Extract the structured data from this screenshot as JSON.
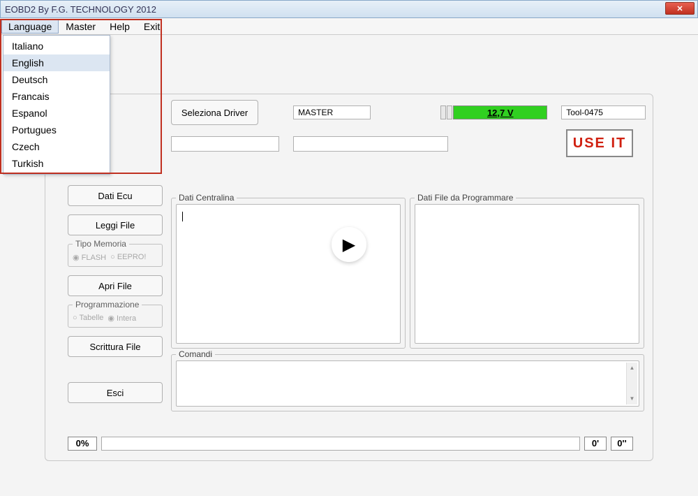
{
  "title": "EOBD2 By F.G. TECHNOLOGY 2012",
  "menu": {
    "items": [
      "Language",
      "Master",
      "Help",
      "Exit"
    ]
  },
  "dropdown": {
    "items": [
      "Italiano",
      "English",
      "Deutsch",
      "Francais",
      "Espanol",
      "Portugues",
      "Czech",
      "Turkish"
    ],
    "selected": "English"
  },
  "top": {
    "seleziona_driver": "Seleziona Driver",
    "master": "MASTER",
    "voltage": "12,7 V",
    "tool": "Tool-0475",
    "use_it": "USE  IT"
  },
  "side": {
    "dati_ecu": "Dati Ecu",
    "leggi_file": "Leggi File",
    "tipo_memoria": "Tipo Memoria",
    "tm_flash": "FLASH",
    "tm_eeprom": "EEPRO!",
    "apri_file": "Apri File",
    "programmazione": "Programmazione",
    "pg_tabelle": "Tabelle",
    "pg_intera": "Intera",
    "scrittura_file": "Scrittura File",
    "esci": "Esci"
  },
  "groups": {
    "dati_centralina": "Dati Centralina",
    "dati_file": "Dati File da Programmare",
    "comandi": "Comandi"
  },
  "status": {
    "pct": "0%",
    "t1": "0'",
    "t2": "0''"
  }
}
